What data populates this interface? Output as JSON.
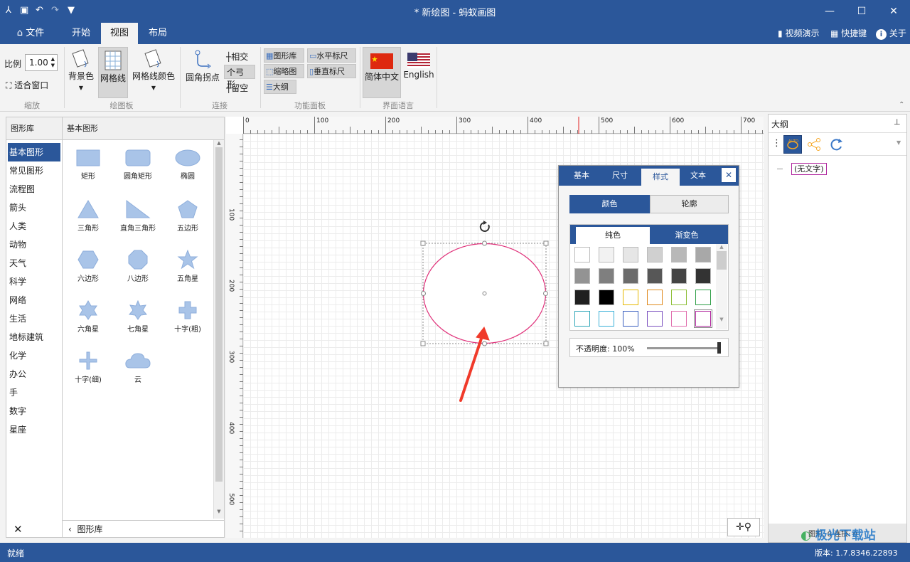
{
  "titlebar": {
    "title": "* 新绘图 - 蚂蚁画图",
    "minimize": "—",
    "maximize": "☐",
    "close": "✕"
  },
  "menu": {
    "file": "文件",
    "start": "开始",
    "view": "视图",
    "layout": "布局",
    "video_demo": "视频演示",
    "shortcuts": "快捷键",
    "about": "关于"
  },
  "ribbon": {
    "scale_label": "比例",
    "scale_value": "1.00",
    "fit_window": "适合窗口",
    "group_zoom": "缩放",
    "bg_color": "背景色",
    "grid_lines": "网格线",
    "grid_line_color": "网格线颜色",
    "group_board": "绘图板",
    "round_corner": "圆角拐点",
    "intersect": "相交",
    "arc": "弓形",
    "gap": "留空",
    "group_connect": "连接",
    "shape_lib": "图形库",
    "h_ruler": "水平标尺",
    "thumbnail": "缩略图",
    "v_ruler": "垂直标尺",
    "outline": "大纲",
    "group_panel": "功能面板",
    "simplified_chinese": "简体中文",
    "english": "English",
    "group_language": "界面语言"
  },
  "library": {
    "header": "图形库",
    "section": "基本图形",
    "categories": [
      "基本图形",
      "常见图形",
      "流程图",
      "箭头",
      "人类",
      "动物",
      "天气",
      "科学",
      "网络",
      "生活",
      "地标建筑",
      "化学",
      "办公",
      "手",
      "数字",
      "星座"
    ],
    "shapes": [
      "矩形",
      "圆角矩形",
      "椭圆",
      "三角形",
      "直角三角形",
      "五边形",
      "六边形",
      "八边形",
      "五角星",
      "六角星",
      "七角星",
      "十字(粗)",
      "十字(细)",
      "云"
    ],
    "footer": "图形库",
    "close": "✕"
  },
  "ruler": {
    "h_ticks": [
      "0",
      "100",
      "200",
      "300",
      "400",
      "500",
      "600",
      "700"
    ],
    "v_ticks": [
      "100",
      "200",
      "300",
      "400",
      "500"
    ]
  },
  "popup": {
    "tabs": [
      "基本",
      "尺寸",
      "样式",
      "文本"
    ],
    "fill_tab": "颜色",
    "stroke_tab": "轮廓",
    "solid": "纯色",
    "gradient": "渐变色",
    "opacity": "不透明度: 100%",
    "close": "✕",
    "swatches": [
      [
        "#ffffff",
        "#f2f2f2",
        "#e6e6e6",
        "#d0d0d0",
        "#b8b8b8",
        "#a8a8a8"
      ],
      [
        "#939393",
        "#7f7f7f",
        "#6b6b6b",
        "#575757",
        "#444444",
        "#333333"
      ],
      [
        "#202020",
        "#000000",
        "#ffffff",
        "#ffffff",
        "#ffffff",
        "#ffffff"
      ],
      [
        "#ffffff",
        "#ffffff",
        "#ffffff",
        "#ffffff",
        "#ffffff",
        "#ffffff"
      ]
    ],
    "swatch_borders": [
      [
        "#bbbbbb",
        "#bbbbbb",
        "#bbbbbb",
        "#bbbbbb",
        "#bbbbbb",
        "#bbbbbb"
      ],
      [
        "#bbbbbb",
        "#bbbbbb",
        "#bbbbbb",
        "#bbbbbb",
        "#bbbbbb",
        "#bbbbbb"
      ],
      [
        "#bbbbbb",
        "#bbbbbb",
        "#e6b800",
        "#e08a1e",
        "#8fbf3a",
        "#2e9e46"
      ],
      [
        "#2ea6b8",
        "#3ab0d8",
        "#3a5fbf",
        "#7a4fbf",
        "#e06fae",
        "#b0269e"
      ]
    ]
  },
  "outline": {
    "title": "大纲",
    "pin": "⊥",
    "item": "(无文字)",
    "footer": "图形: 0 连接: 0"
  },
  "status": {
    "ready": "就绪",
    "version": "版本: 1.7.8346.22893"
  },
  "watermark": "极光下载站",
  "colors": {
    "accent": "#2b579a",
    "ellipse_stroke": "#e0317a",
    "arrow": "#f03a2a"
  }
}
